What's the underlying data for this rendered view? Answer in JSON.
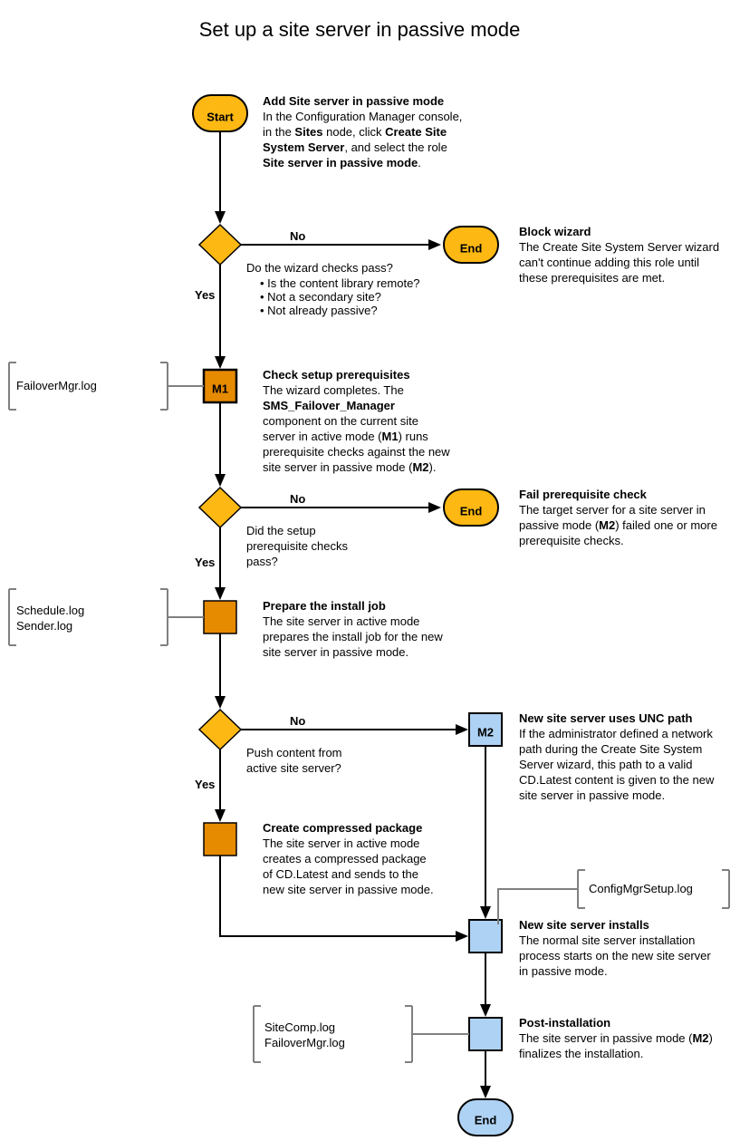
{
  "title": "Set up a site server in passive mode",
  "start": "Start",
  "end": "End",
  "yes": "Yes",
  "no": "No",
  "n1": {
    "t": "Add Site server in passive mode",
    "l1": "In the Configuration Manager console,",
    "l2a": "in the ",
    "l2b": "Sites",
    "l2c": " node, click ",
    "l2d": "Create Site",
    "l3a": "System Server",
    "l3b": ", and select the role",
    "l4": "Site server in passive mode",
    "l4b": "."
  },
  "d1": {
    "q": "Do the wizard checks pass?",
    "b1": "Is the content library remote?",
    "b2": "Not a secondary site?",
    "b3": "Not already passive?"
  },
  "e1": {
    "t": "Block wizard",
    "l1": "The Create Site System Server wizard",
    "l2": "can't continue adding this role until",
    "l3": "these prerequisites are met."
  },
  "m1": "M1",
  "m2": "M2",
  "n2": {
    "t": "Check setup prerequisites",
    "l1": "The wizard completes. The",
    "l2": "SMS_Failover_Manager",
    "l3": "component on the current site",
    "l4a": "server in active mode (",
    "l4b": "M1",
    "l4c": ") runs",
    "l5": "prerequisite checks against the new",
    "l6a": "site server in passive mode (",
    "l6b": "M2",
    "l6c": ")."
  },
  "d2": {
    "l1": "Did the setup",
    "l2": "prerequisite checks",
    "l3": "pass?"
  },
  "e2": {
    "t": "Fail prerequisite check",
    "l1": "The target server for a site server in",
    "l2a": "passive mode (",
    "l2b": "M2",
    "l2c": ") failed one or more",
    "l3": "prerequisite checks."
  },
  "n3": {
    "t": "Prepare the install job",
    "l1": "The site server in active mode",
    "l2": "prepares the install job for the new",
    "l3": "site server in passive mode."
  },
  "d3": {
    "l1": "Push content from",
    "l2": "active site server?"
  },
  "n4": {
    "t": "New site server uses UNC path",
    "l1": "If the administrator defined a network",
    "l2": "path during the Create Site System",
    "l3": "Server wizard, this path to a valid",
    "l4": "CD.Latest content is given to the new",
    "l5": "site server in passive mode."
  },
  "n5": {
    "t": "Create compressed package",
    "l1": "The site server in active mode",
    "l2": "creates a compressed package",
    "l3": "of CD.Latest and sends to the",
    "l4": "new site server in passive mode."
  },
  "n6": {
    "t": "New site server installs",
    "l1": "The normal site server installation",
    "l2": "process starts on the new site server",
    "l3": "in passive mode."
  },
  "n7": {
    "t": "Post-installation",
    "l1a": "The site server in passive mode (",
    "l1b": "M2",
    "l1c": ")",
    "l2": "finalizes the installation."
  },
  "g1": "FailoverMgr.log",
  "g2a": "Schedule.log",
  "g2b": "Sender.log",
  "g3": "ConfigMgrSetup.log",
  "g4a": "SiteComp.log",
  "g4b": "FailoverMgr.log"
}
